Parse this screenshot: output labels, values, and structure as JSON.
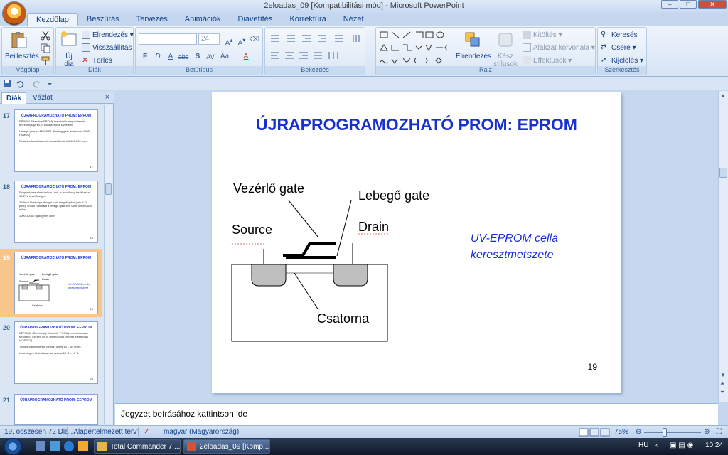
{
  "window": {
    "title": "2eloadas_09 [Kompatibilitási mód] - Microsoft PowerPoint",
    "controls": [
      "–",
      "□",
      "✕"
    ]
  },
  "ribbon": {
    "tabs": [
      "Kezdőlap",
      "Beszúrás",
      "Tervezés",
      "Animációk",
      "Diavetítés",
      "Korrektúra",
      "Nézet"
    ],
    "active_tab": "Kezdőlap",
    "groups": {
      "clipboard": {
        "title": "Vágólap",
        "paste": "Beillesztés"
      },
      "slides": {
        "title": "Diák",
        "new_slide_line1": "Új",
        "new_slide_line2": "dia",
        "layout": "Elrendezés",
        "reset": "Visszaállítás",
        "delete": "Törlés"
      },
      "font": {
        "title": "Betűtípus",
        "font_size": "24"
      },
      "paragraph": {
        "title": "Bekezdés"
      },
      "drawing": {
        "title": "Rajz",
        "arrange": "Elrendezés",
        "quick_styles_line1": "Kész",
        "quick_styles_line2": "stílusok",
        "fill": "Kitöltés",
        "outline": "Alakzat körvonala",
        "effects": "Effektusok"
      },
      "editing": {
        "title": "Szerkesztés",
        "find": "Keresés",
        "replace": "Csere",
        "select": "Kijelölés"
      }
    }
  },
  "panel": {
    "tabs": [
      "Diák",
      "Vázlat"
    ],
    "close": "×",
    "thumbnails": [
      {
        "num": "17",
        "title": "ÚJRAPROGRAMOZHATÓ PROM: EPROM",
        "text": "EPROM (Erasable PROM) áramkörök megoldása és technológiája MOS tranzisztoros kivitelben.",
        "text2": "Lebegő gate-es MOSFET (floating-gate avalanche MOS, FAMOS)",
        "text3": "Relatív a lassú áramkör, hozzáférési idő 100-300 nsec.",
        "page": "17"
      },
      {
        "num": "18",
        "title": "ÚJRAPROGRAMOZHATÓ PROM: EPROM",
        "text": "Programozás elektronikus úton, a feszültség beállítással 12-21V feszültséggel.",
        "text2": "Törlés: Ultraibolya fénnyel való megvilágítás (min 3-10 perc), ennek hatására a lebegő gate-ben tárolt információ elillan.",
        "text3": "1000-10000 újraégetés kibír.",
        "page": "18"
      },
      {
        "num": "19",
        "title": "ÚJRAPROGRAMOZHATÓ PROM: EPROM",
        "text": "",
        "text2": "",
        "text3": "",
        "page": "19"
      },
      {
        "num": "20",
        "title": "ÚJRAPROGRAMOZHATÓ PROM: EEPROM",
        "text": "EEPROM (Electrically Erasable PROM): elektromosan törölhető. Szintén MOS technológia (lebegő elektródás MOSFET).",
        "text2": "Tipikus paraméterek: beírás, törlés 10 – 50 msec.",
        "text3": "Lehetséges törlési/újraírási száma 10^4 – 10^5.",
        "page": "20"
      },
      {
        "num": "21",
        "title": "ÚJRAPROGRAMOZHATÓ PROM: EEPROM",
        "text": "",
        "text2": "",
        "text3": "",
        "page": ""
      }
    ]
  },
  "slide": {
    "title": "ÚJRAPROGRAMOZHATÓ PROM: EPROM",
    "labels": {
      "control_gate": "Vezérlő gate",
      "floating_gate": "Lebegő gate",
      "source": "Source",
      "drain": "Drain",
      "channel": "Csatorna"
    },
    "caption_line1": "UV-EPROM cella",
    "caption_line2": "keresztmetszete",
    "number": "19"
  },
  "notes": {
    "placeholder": "Jegyzet beírásához kattintson ide"
  },
  "statusbar": {
    "slide_info": "19, összesen 72 Dia",
    "theme": "„Alapértelmezett terv”",
    "language": "magyar (Magyarország)",
    "zoom": "75%"
  },
  "taskbar": {
    "tasks": [
      "Total Commander 7....",
      "2eloadas_09 [Komp..."
    ],
    "lang": "HU",
    "time": "10:24"
  }
}
